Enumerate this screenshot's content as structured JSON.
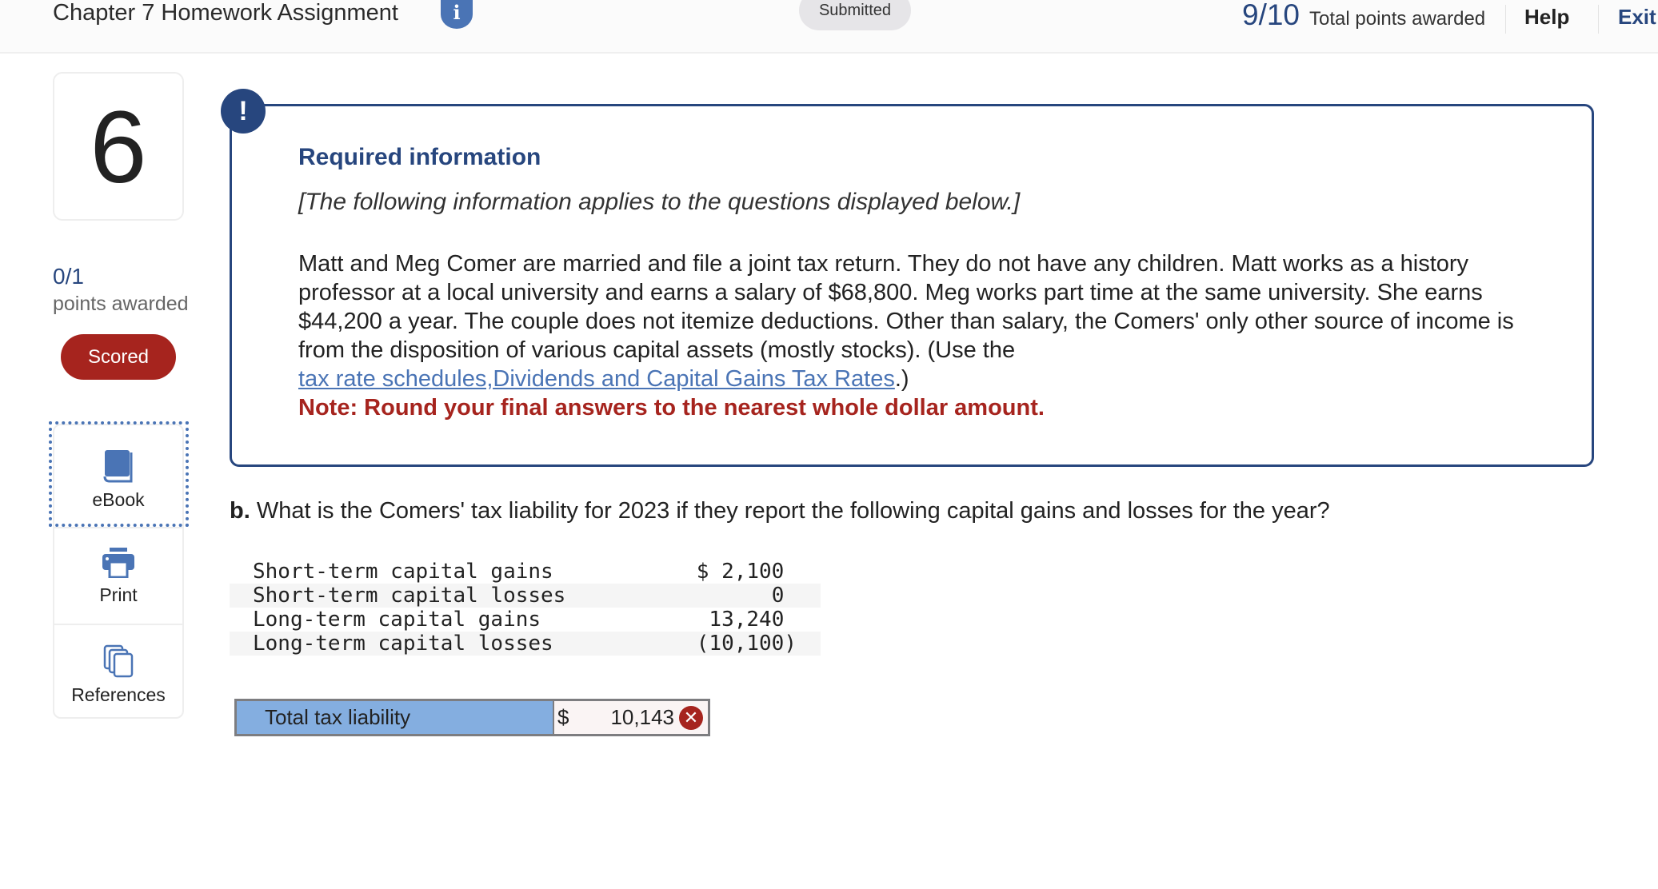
{
  "header": {
    "title": "Chapter 7 Homework Assignment",
    "info_icon": "info-icon",
    "status": "Submitted",
    "total_points": "9/10",
    "total_points_label": "Total points awarded",
    "help": "Help",
    "exit": "Exit"
  },
  "sidebar": {
    "question_number": "6",
    "points": "0/1",
    "points_label": "points awarded",
    "scored_label": "Scored",
    "tools": [
      {
        "label": "eBook",
        "icon": "book-icon"
      },
      {
        "label": "Print",
        "icon": "printer-icon"
      },
      {
        "label": "References",
        "icon": "documents-icon"
      }
    ]
  },
  "info": {
    "alert_icon": "!",
    "title": "Required information",
    "subtitle": "[The following information applies to the questions displayed below.]",
    "paragraph": "Matt and Meg Comer are married and file a joint tax return. They do not have any children. Matt works as a history professor at a local university and earns a salary of $68,800. Meg works part time at the same university. She earns $44,200 a year. The couple does not itemize deductions. Other than salary, the Comers' only other source of income is from the disposition of various capital assets (mostly stocks). (Use the ",
    "link1": "tax rate schedules,",
    "link2": "Dividends and Capital Gains Tax Rates",
    "after_links": ".)",
    "note": "Note: Round your final answers to the nearest whole dollar amount."
  },
  "question": {
    "prefix": "b.",
    "text": " What is the Comers' tax liability for 2023 if they report the following capital gains and losses for the year?",
    "rows": [
      {
        "label": "Short-term capital gains",
        "value": "$ 2,100 "
      },
      {
        "label": "Short-term capital losses",
        "value": "0 "
      },
      {
        "label": "Long-term capital gains",
        "value": "13,240 "
      },
      {
        "label": "Long-term capital losses",
        "value": "(10,100)"
      }
    ]
  },
  "answer": {
    "label": "Total tax liability",
    "currency": "$",
    "value": "10,143",
    "status": "incorrect",
    "status_icon": "✕"
  }
}
